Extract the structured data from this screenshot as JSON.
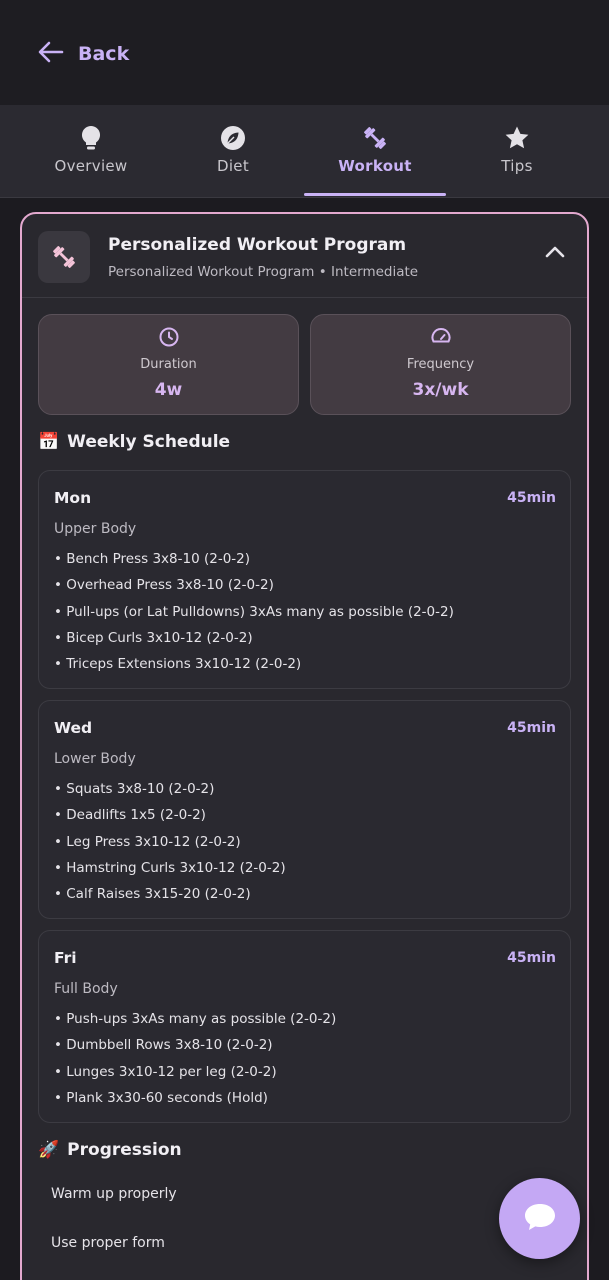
{
  "header": {
    "back_label": "Back",
    "back_icon": "arrow-left-icon"
  },
  "tabs": [
    {
      "label": "Overview",
      "icon": "lightbulb-icon",
      "active": false
    },
    {
      "label": "Diet",
      "icon": "leaf-icon",
      "active": false
    },
    {
      "label": "Workout",
      "icon": "dumbbell-icon",
      "active": true
    },
    {
      "label": "Tips",
      "icon": "star-icon",
      "active": false
    }
  ],
  "program": {
    "title": "Personalized Workout Program",
    "subtitle": "Personalized Workout Program • Intermediate",
    "icon": "dumbbell-icon",
    "collapse_icon": "chevron-up-icon"
  },
  "stats": [
    {
      "label": "Duration",
      "value": "4w",
      "icon": "clock-icon"
    },
    {
      "label": "Frequency",
      "value": "3x/wk",
      "icon": "gauge-icon"
    }
  ],
  "schedule": {
    "title": "Weekly Schedule",
    "emoji": "📅",
    "days": [
      {
        "day": "Mon",
        "duration": "45min",
        "focus": "Upper Body",
        "exercises": [
          "• Bench Press 3x8-10 (2-0-2)",
          "• Overhead Press 3x8-10 (2-0-2)",
          "• Pull-ups (or Lat Pulldowns) 3xAs many as possible (2-0-2)",
          "• Bicep Curls 3x10-12 (2-0-2)",
          "• Triceps Extensions 3x10-12 (2-0-2)"
        ]
      },
      {
        "day": "Wed",
        "duration": "45min",
        "focus": "Lower Body",
        "exercises": [
          "• Squats 3x8-10 (2-0-2)",
          "• Deadlifts 1x5 (2-0-2)",
          "• Leg Press 3x10-12 (2-0-2)",
          "• Hamstring Curls 3x10-12 (2-0-2)",
          "• Calf Raises 3x15-20 (2-0-2)"
        ]
      },
      {
        "day": "Fri",
        "duration": "45min",
        "focus": "Full Body",
        "exercises": [
          "• Push-ups 3xAs many as possible (2-0-2)",
          "• Dumbbell Rows 3x8-10 (2-0-2)",
          "• Lunges 3x10-12 per leg (2-0-2)",
          "• Plank 3x30-60 seconds (Hold)"
        ]
      }
    ]
  },
  "progression": {
    "title": "Progression",
    "emoji": "🚀",
    "items": [
      "Warm up properly",
      "Use proper form"
    ]
  },
  "fab": {
    "icon": "chat-bubble-icon"
  },
  "colors": {
    "accent": "#c9b2f5",
    "card_border": "#e3a9cf",
    "background": "#1c1b20"
  }
}
